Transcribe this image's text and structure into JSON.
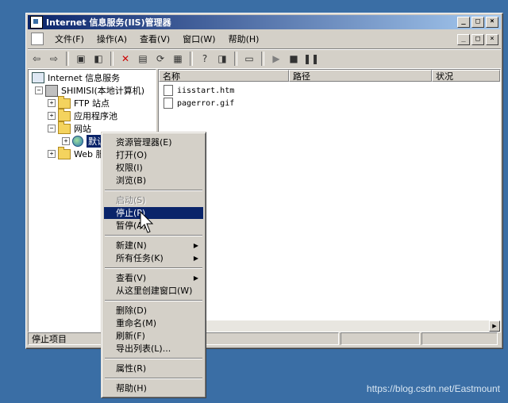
{
  "window": {
    "title": "Internet 信息服务(IIS)管理器"
  },
  "menu": [
    "文件(F)",
    "操作(A)",
    "查看(V)",
    "窗口(W)",
    "帮助(H)"
  ],
  "window_buttons": [
    "_",
    "□",
    "×"
  ],
  "tree": {
    "root": "Internet 信息服务",
    "computer": "SHIMISI(本地计算机)",
    "ftp": "FTP 站点",
    "pools": "应用程序池",
    "sites": "网站",
    "default_site": "默认网站",
    "web_ext": "Web 服务扩展"
  },
  "list": {
    "columns": [
      "名称",
      "路径",
      "状况"
    ],
    "files": [
      "iisstart.htm",
      "pagerror.gif"
    ]
  },
  "status": {
    "text": "停止项目"
  },
  "context_menu": {
    "items": {
      "explorer": "资源管理器(E)",
      "open": "打开(O)",
      "permissions": "权限(I)",
      "browse": "浏览(B)",
      "start": "启动(S)",
      "stop": "停止(P)",
      "pause": "暂停(A)",
      "new": "新建(N)",
      "all_tasks": "所有任务(K)",
      "view": "查看(V)",
      "new_window": "从这里创建窗口(W)",
      "delete": "删除(D)",
      "rename": "重命名(M)",
      "refresh": "刷新(F)",
      "export": "导出列表(L)...",
      "properties": "属性(R)",
      "help": "帮助(H)"
    }
  },
  "watermark": "https://blog.csdn.net/Eastmount"
}
